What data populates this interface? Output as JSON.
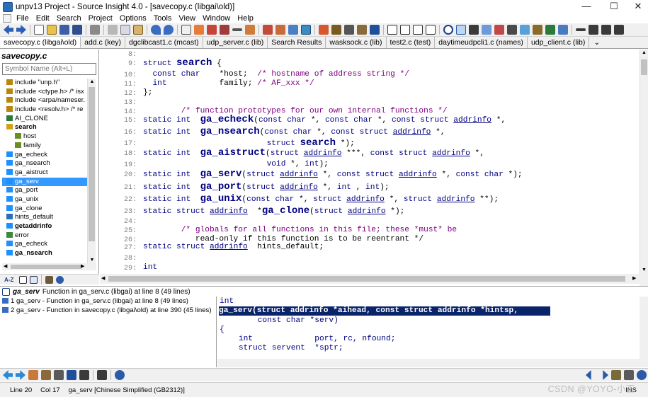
{
  "window": {
    "title": "unpv13 Project - Source Insight 4.0 - [savecopy.c (libgai\\old)]",
    "minimize": "—",
    "maximize": "☐",
    "close": "✕"
  },
  "menu": [
    "File",
    "Edit",
    "Search",
    "Project",
    "Options",
    "Tools",
    "View",
    "Window",
    "Help"
  ],
  "tabs": [
    "savecopy.c (libgai\\old)",
    "add.c (key)",
    "dgclibcast1.c (mcast)",
    "udp_server.c (lib)",
    "Search Results",
    "wasksock.c (lib)",
    "test2.c (test)",
    "daytimeudpcli1.c (names)",
    "udp_client.c (lib)",
    "⌄"
  ],
  "symbol_panel": {
    "title": "savecopy.c",
    "search_placeholder": "Symbol Name (Alt+L)",
    "items": [
      {
        "label": "include \"unp.h\"",
        "icon": "include-icon",
        "indent": 0,
        "bold": false
      },
      {
        "label": "include <ctype.h> /* isx",
        "icon": "include-icon",
        "indent": 0,
        "bold": false
      },
      {
        "label": "include <arpa/nameser.",
        "icon": "include-icon",
        "indent": 0,
        "bold": false
      },
      {
        "label": "include <resolv.h> /* re",
        "icon": "include-icon",
        "indent": 0,
        "bold": false
      },
      {
        "label": "AI_CLONE",
        "icon": "macro-icon",
        "indent": 0,
        "bold": false
      },
      {
        "label": "search",
        "icon": "struct-icon",
        "indent": 0,
        "bold": true
      },
      {
        "label": "host",
        "icon": "field-icon",
        "indent": 1,
        "bold": false
      },
      {
        "label": "family",
        "icon": "field-icon",
        "indent": 1,
        "bold": false
      },
      {
        "label": "ga_echeck",
        "icon": "function-icon",
        "indent": 0,
        "bold": false
      },
      {
        "label": "ga_nsearch",
        "icon": "function-icon",
        "indent": 0,
        "bold": false
      },
      {
        "label": "ga_aistruct",
        "icon": "function-icon",
        "indent": 0,
        "bold": false
      },
      {
        "label": "ga_serv",
        "icon": "function-icon",
        "indent": 0,
        "bold": false
      },
      {
        "label": "ga_port",
        "icon": "function-icon",
        "indent": 0,
        "bold": false
      },
      {
        "label": "ga_unix",
        "icon": "function-icon",
        "indent": 0,
        "bold": false
      },
      {
        "label": "ga_clone",
        "icon": "function-icon",
        "indent": 0,
        "bold": false
      },
      {
        "label": "hints_default",
        "icon": "variable-icon",
        "indent": 0,
        "bold": false
      },
      {
        "label": "getaddrinfo",
        "icon": "function-icon",
        "indent": 0,
        "bold": true
      },
      {
        "label": "error",
        "icon": "label-icon",
        "indent": 0,
        "bold": false
      },
      {
        "label": "ga_echeck",
        "icon": "function-icon",
        "indent": 0,
        "bold": false
      },
      {
        "label": "ga_nsearch",
        "icon": "function-icon",
        "indent": 0,
        "bold": true
      }
    ],
    "selected_index": 11
  },
  "editor": {
    "lines": [
      {
        "n": "8:",
        "code": ""
      },
      {
        "n": "9:",
        "code": "struct search {"
      },
      {
        "n": "10:",
        "code": "  const char    *host;  /* hostname of address string */"
      },
      {
        "n": "11:",
        "code": "  int           family; /* AF_xxx */"
      },
      {
        "n": "12:",
        "code": "};"
      },
      {
        "n": "13:",
        "code": ""
      },
      {
        "n": "14:",
        "code": "        /* function prototypes for our own internal functions */"
      },
      {
        "n": "15:",
        "code": "static int  ga_echeck(const char *, const char *, const struct addrinfo *,"
      },
      {
        "n": "16:",
        "code": "static int  ga_nsearch(const char *, const struct addrinfo *,"
      },
      {
        "n": "17:",
        "code": "                          struct search *);"
      },
      {
        "n": "18:",
        "code": "static int  ga_aistruct(struct addrinfo ***, const struct addrinfo *,"
      },
      {
        "n": "19:",
        "code": "                          void *, int);"
      },
      {
        "n": "20:",
        "code": "static int  ga_serv(struct addrinfo *, const struct addrinfo *, const char *);"
      },
      {
        "n": "21:",
        "code": "static int  ga_port(struct addrinfo *, int , int);"
      },
      {
        "n": "22:",
        "code": "static int  ga_unix(const char *, struct addrinfo *, struct addrinfo **);"
      },
      {
        "n": "23:",
        "code": "static struct addrinfo  *ga_clone(struct addrinfo *);"
      },
      {
        "n": "24:",
        "code": ""
      },
      {
        "n": "25:",
        "code": "        /* globals for all functions in this file; these *must* be"
      },
      {
        "n": "26:",
        "code": "           read-only if this function is to be reentrant */"
      },
      {
        "n": "27:",
        "code": "static struct addrinfo  hints_default;"
      },
      {
        "n": "28:",
        "code": ""
      },
      {
        "n": "29:",
        "code": "int"
      }
    ]
  },
  "relation": {
    "symbol": "ga_serv",
    "description": "Function in ga_serv.c (libgai) at line 8 (49 lines)",
    "references": [
      "1 ga_serv - Function in ga_serv.c (libgai) at line 8 (49 lines)",
      "2 ga_serv - Function in savecopy.c (libgai\\old) at line 390 (45 lines)"
    ]
  },
  "context": {
    "lines": [
      "int",
      "ga_serv(struct addrinfo *aihead, const struct addrinfo *hintsp,",
      "        const char *serv)",
      "{",
      "    int             port, rc, nfound;",
      "    struct servent  *sptr;"
    ]
  },
  "status": {
    "line": "Line 20",
    "col": "Col 17",
    "symbol": "ga_serv [Chinese Simplified (GB2312)]",
    "mode": "INS"
  },
  "watermark": "CSDN @YOYO-小王"
}
